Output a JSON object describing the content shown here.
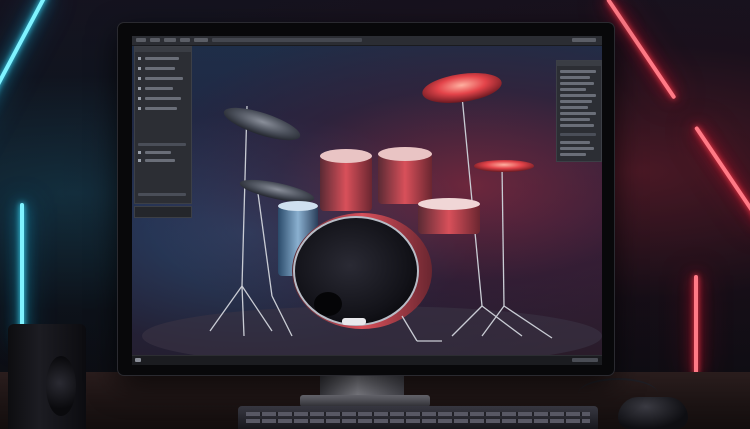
{
  "scene": {
    "description_type": "photograph",
    "colors": {
      "neon_left": "#7ff3ff",
      "neon_right": "#ff7a86",
      "wall": "#15131f",
      "desk": "#2a1d1d",
      "monitor_bezel": "#08080a",
      "ui_panel": "#2c2e34"
    }
  },
  "monitor": {
    "app": {
      "toolbar_icons": [
        "file-icon",
        "edit-icon",
        "tools-icon",
        "view-icon",
        "render-icon",
        "settings-icon"
      ],
      "left_panel_tools": 12,
      "right_panel_rows": 16,
      "image_subject": "drum-kit"
    }
  },
  "desk_items": [
    "keyboard",
    "mouse",
    "speaker"
  ]
}
